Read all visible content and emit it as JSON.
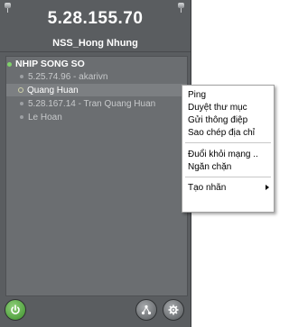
{
  "header": {
    "ip": "5.28.155.70",
    "user": "NSS_Hong Nhung"
  },
  "contacts": {
    "group": "NHIP SONG SO",
    "items": [
      {
        "name": "5.25.74.96 - akarivn",
        "status": "offline"
      },
      {
        "name": "Quang Huan",
        "status": "online"
      },
      {
        "name": "5.28.167.14 - Tran Quang Huan",
        "status": "offline"
      },
      {
        "name": "Le Hoan",
        "status": "offline"
      }
    ]
  },
  "context_menu": {
    "items": [
      {
        "label": "Ping"
      },
      {
        "label": "Duyệt thư mục"
      },
      {
        "label": "Gửi thông điệp"
      },
      {
        "label": "Sao chép địa chỉ"
      },
      {
        "label": "Đuổi khỏi mạng .."
      },
      {
        "label": "Ngăn chặn"
      },
      {
        "label": "Tạo nhãn"
      }
    ]
  },
  "icons": {
    "power": "power-icon",
    "network": "network-icon",
    "settings": "gear-icon"
  }
}
